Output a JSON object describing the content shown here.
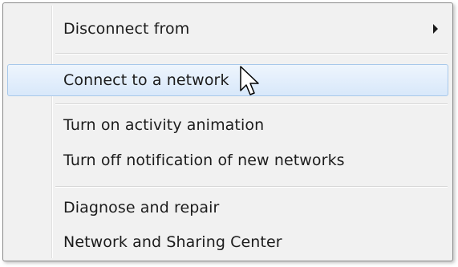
{
  "menu": {
    "items": [
      {
        "label": "Disconnect from",
        "has_submenu": true
      },
      {
        "label": "Connect to a network",
        "highlighted": true
      },
      {
        "label": "Turn on activity animation"
      },
      {
        "label": "Turn off notification of new networks"
      },
      {
        "label": "Diagnose and repair"
      },
      {
        "label": "Network and Sharing Center"
      }
    ]
  },
  "colors": {
    "menu_background": "#f1f1f1",
    "highlight_top": "#eef5fd",
    "highlight_bottom": "#d8e8fa",
    "highlight_border": "#a7c8ea"
  },
  "icons": {
    "submenu": "chevron-right-icon",
    "pointer": "mouse-cursor-icon"
  }
}
